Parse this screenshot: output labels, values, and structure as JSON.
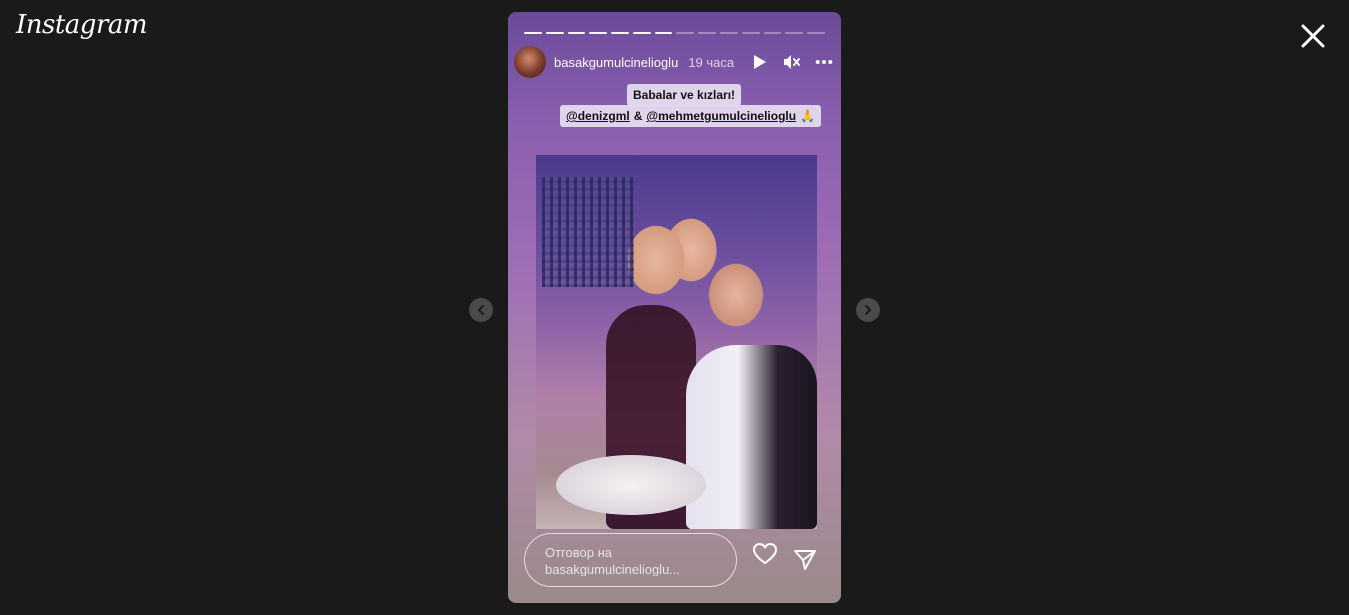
{
  "brand": {
    "logo_text": "Instagram"
  },
  "story": {
    "username": "basakgumulcinelioglu",
    "time_ago": "19 часа",
    "progress": {
      "total_segments": 14,
      "completed_segments": 7
    },
    "caption_line1": "Babalar ve kızları!",
    "caption_mention1": "@denizgml",
    "caption_amp": "&",
    "caption_mention2": "@mehmetgumulcinelioglu",
    "caption_emoji": "🙏",
    "reply_placeholder": "Отговор на basakgumulcinelioglu..."
  },
  "icons": {
    "close": "close-icon",
    "prev": "chevron-left-icon",
    "next": "chevron-right-icon",
    "play": "play-icon",
    "mute": "muted-speaker-icon",
    "more": "more-options-icon",
    "like": "heart-icon",
    "share": "send-icon"
  },
  "colors": {
    "page_background": "#1a1a1a",
    "story_gradient_top": "#6b4a9a",
    "story_gradient_bottom": "#9a8a8a"
  }
}
